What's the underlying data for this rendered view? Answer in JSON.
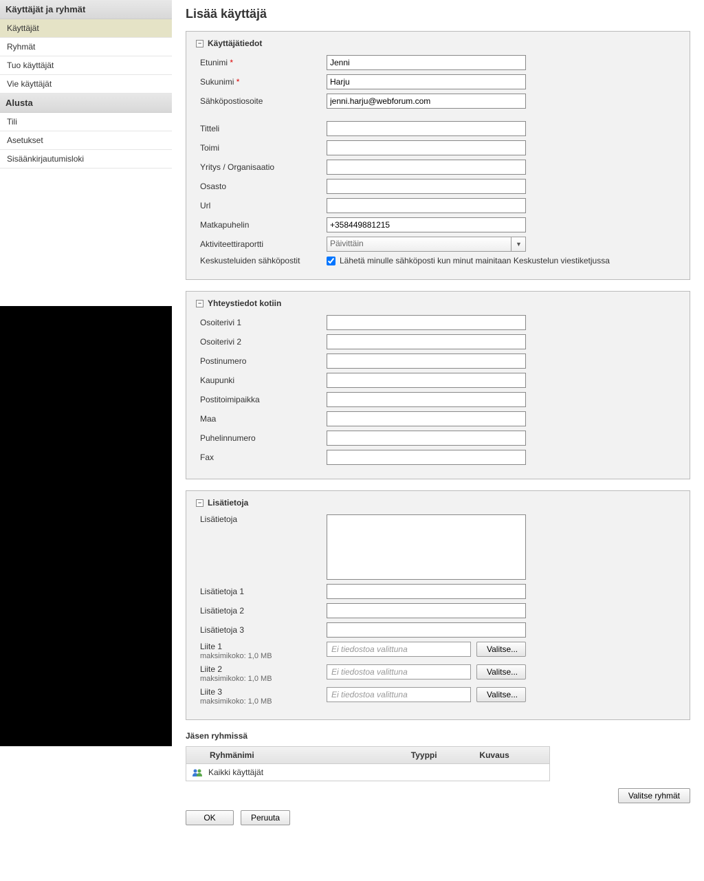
{
  "sidebar": {
    "header1": "Käyttäjät ja ryhmät",
    "items1": [
      "Käyttäjät",
      "Ryhmät",
      "Tuo käyttäjät",
      "Vie käyttäjät"
    ],
    "header2": "Alusta",
    "items2": [
      "Tili",
      "Asetukset",
      "Sisäänkirjautumisloki"
    ]
  },
  "page": {
    "title": "Lisää käyttäjä"
  },
  "panel1": {
    "title": "Käyttäjätiedot",
    "firstname_label": "Etunimi",
    "firstname": "Jenni",
    "lastname_label": "Sukunimi",
    "lastname": "Harju",
    "email_label": "Sähköpostiosoite",
    "email": "jenni.harju@webforum.com",
    "title_label": "Titteli",
    "role_label": "Toimi",
    "org_label": "Yritys / Organisaatio",
    "dept_label": "Osasto",
    "url_label": "Url",
    "mobile_label": "Matkapuhelin",
    "mobile": "+358449881215",
    "activity_label": "Aktiviteettiraportti",
    "activity_value": "Päivittäin",
    "discuss_label": "Keskusteluiden sähköpostit",
    "discuss_check": "Lähetä minulle sähköposti kun minut mainitaan Keskustelun viestiketjussa"
  },
  "panel2": {
    "title": "Yhteystiedot kotiin",
    "addr1_label": "Osoiterivi 1",
    "addr2_label": "Osoiterivi 2",
    "zip_label": "Postinumero",
    "city_label": "Kaupunki",
    "postoffice_label": "Postitoimipaikka",
    "country_label": "Maa",
    "phone_label": "Puhelinnumero",
    "fax_label": "Fax"
  },
  "panel3": {
    "title": "Lisätietoja",
    "extra_label": "Lisätietoja",
    "extra1_label": "Lisätietoja 1",
    "extra2_label": "Lisätietoja 2",
    "extra3_label": "Lisätietoja 3",
    "attach1_label": "Liite 1",
    "attach2_label": "Liite 2",
    "attach3_label": "Liite 3",
    "maxsize": "maksimikoko: 1,0 MB",
    "no_file": "Ei tiedostoa valittuna",
    "choose": "Valitse..."
  },
  "groups": {
    "section_title": "Jäsen ryhmissä",
    "col_name": "Ryhmänimi",
    "col_type": "Tyyppi",
    "col_desc": "Kuvaus",
    "row1": "Kaikki käyttäjät",
    "select_btn": "Valitse ryhmät"
  },
  "buttons": {
    "ok": "OK",
    "cancel": "Peruuta"
  }
}
